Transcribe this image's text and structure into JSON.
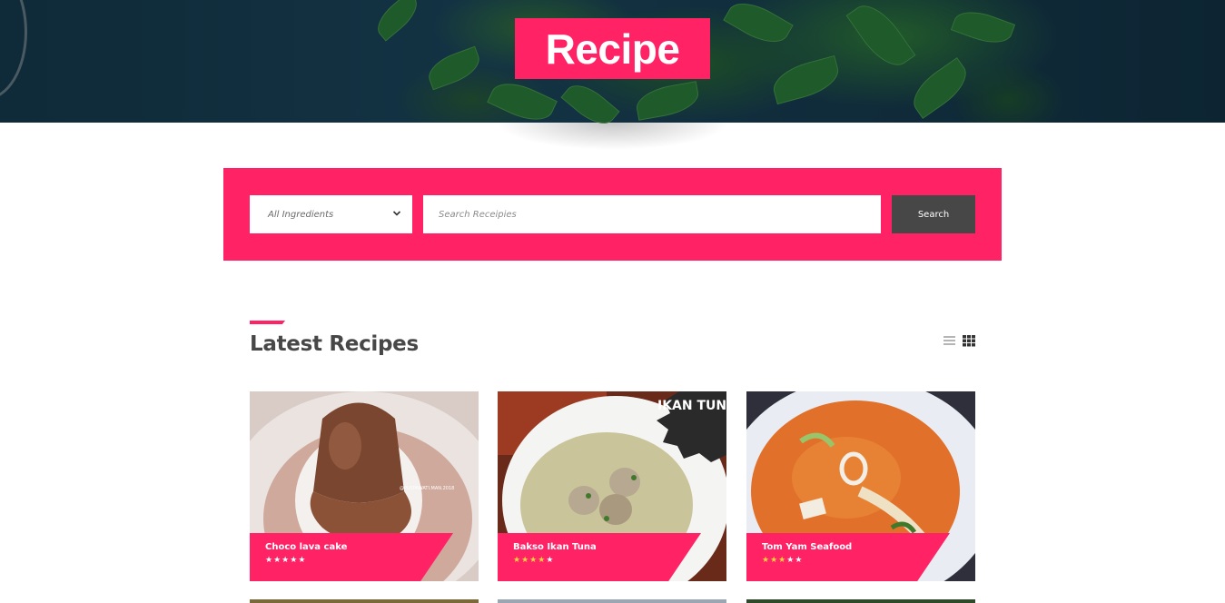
{
  "hero": {
    "title": "Recipe"
  },
  "search": {
    "category_value": "All Ingredients",
    "placeholder": "Search Receipies",
    "button_label": "Search"
  },
  "section": {
    "title": "Latest Recipes",
    "views": [
      "list-view-icon",
      "grid-view-icon"
    ],
    "active_view": "grid"
  },
  "recipes": [
    {
      "name": "Choco lava cake",
      "rating": 0,
      "photo_text": "@PUSPAWATI.MAN.2018"
    },
    {
      "name": "Bakso Ikan Tuna",
      "rating": 4,
      "photo_text": "IKAN TUNA"
    },
    {
      "name": "Tom Yam Seafood",
      "rating": 3
    }
  ],
  "colors": {
    "accent": "#ff2366",
    "dark": "#474747",
    "star_on": "#ffd23a",
    "star_off": "#ffffff"
  }
}
